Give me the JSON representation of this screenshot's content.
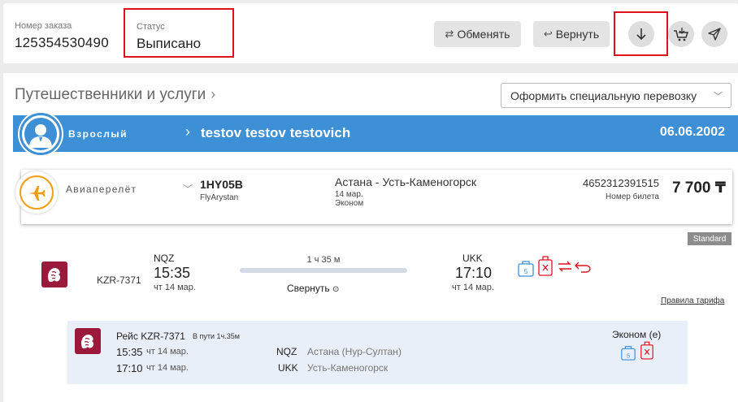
{
  "header": {
    "order_label": "Номер заказа",
    "order_number": "125354530490",
    "status_label": "Статус",
    "status_value": "Выписано",
    "exchange_label": "Обменять",
    "refund_label": "Вернуть",
    "download_icon": "download-arrow-icon",
    "basket_icon": "basket-icon",
    "send_icon": "send-icon"
  },
  "section": {
    "title": "Путешественники и услуги",
    "special_select": "Оформить специальную перевозку"
  },
  "passenger": {
    "type": "Взрослый",
    "name": "testov testov testovich",
    "dob": "06.06.2002"
  },
  "service": {
    "type": "Авиаперелёт",
    "pnr": "1HY05B",
    "airline": "FlyArystan",
    "route": "Астана - Усть-Каменогорск",
    "date": "14 мар.",
    "class": "Эконом",
    "ticket_number": "4652312391515",
    "ticket_label": "Номер билета",
    "price": "7 700 ₸"
  },
  "tariff_badge": "Standard",
  "segment": {
    "flight": "KZR-7371",
    "from_code": "NQZ",
    "from_time": "15:35",
    "from_date": "чт 14 мар.",
    "duration": "1 ч 35 м",
    "collapse_label": "Свернуть",
    "to_code": "UKK",
    "to_time": "17:10",
    "to_date": "чт 14 мар.",
    "tariff_rules": "Правила тарифа"
  },
  "detail": {
    "title": "Рейс KZR-7371",
    "transit": "В пути 1ч.35м",
    "dep_time": "15:35",
    "dep_date": "чт 14 мар.",
    "dep_code": "NQZ",
    "dep_city": "Астана (Нур-Султан)",
    "arr_time": "17:10",
    "arr_date": "чт 14 мар.",
    "arr_code": "UKK",
    "arr_city": "Усть-Каменогорск",
    "class": "Эконом (е)"
  },
  "colors": {
    "accent_blue": "#3d8fd6",
    "highlight_red": "#e0101c",
    "airline_logo": "#9b1a3b",
    "flight_orange": "#f39c12"
  }
}
